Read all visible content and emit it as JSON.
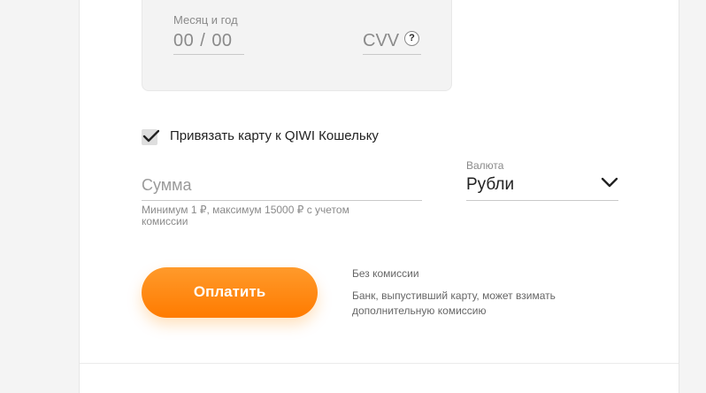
{
  "card": {
    "expiry_label": "Месяц и год",
    "expiry_month": "00",
    "expiry_separator": "/",
    "expiry_year": "00",
    "cvv_placeholder": "CVV",
    "cvv_help": "?"
  },
  "link_card": {
    "checked": true,
    "label": "Привязать карту к QIWI Кошельку"
  },
  "amount": {
    "placeholder": "Сумма",
    "hint": "Минимум 1 ₽, максимум 15000 ₽ с учетом комиссии"
  },
  "currency": {
    "label": "Валюта",
    "selected": "Рубли"
  },
  "pay": {
    "button_label": "Оплатить",
    "fee_title": "Без комиссии",
    "fee_note": "Банк, выпустивший карту, может взимать дополнительную комиссию"
  },
  "colors": {
    "accent": "#ff8c00",
    "background": "#f4f4f4",
    "panel": "#ffffff"
  }
}
